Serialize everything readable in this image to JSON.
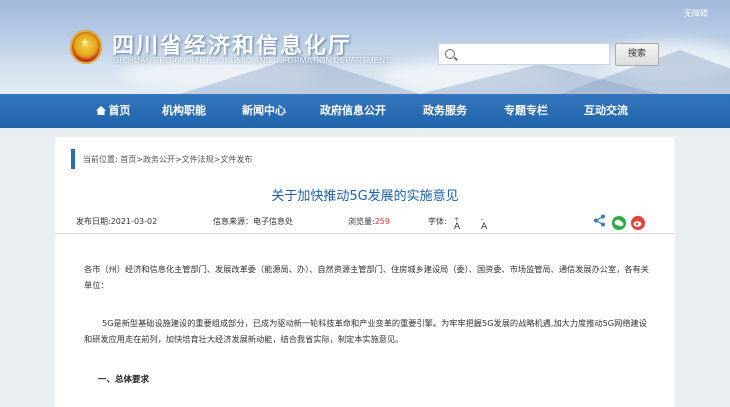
{
  "header": {
    "accessibility_label": "无障碍",
    "site_title": "四川省经济和信息化厅",
    "site_subtitle": "SICHUAN PROVINCIAL ECONOMIC AND INFORMATION DEPARTMENT",
    "search": {
      "placeholder": "",
      "value": "",
      "button_label": "搜索"
    }
  },
  "nav": {
    "items": [
      {
        "label": "首页",
        "icon": "home-icon"
      },
      {
        "label": "机构职能"
      },
      {
        "label": "新闻中心"
      },
      {
        "label": "政府信息公开"
      },
      {
        "label": "政务服务"
      },
      {
        "label": "专题专栏"
      },
      {
        "label": "互动交流"
      }
    ]
  },
  "breadcrumb": {
    "prefix": "当前位置:",
    "path": "首页>政务公开>文件法规>文件发布"
  },
  "article": {
    "title": "关于加快推动5G发展的实施意见",
    "meta": {
      "date_label": "发布日期:2021-03-02",
      "source_label": "信息来源：电子信息处",
      "views_label": "浏览量:",
      "views_value": "259",
      "font_label": "字体:",
      "font_increase": "A",
      "font_decrease": "A",
      "share_icons": [
        "share-icon",
        "wechat-icon",
        "weibo-icon"
      ]
    },
    "paragraphs": [
      "各市（州）经济和信息化主管部门、发展改革委（能源局、办）、自然资源主管部门、住房城乡建设局（委）、国资委、市场监管局、通信发展办公室，各有关单位：",
      "5G是新型基础设施建设的重要组成部分，已成为驱动新一轮科技革命和产业变革的重要引擎。为牢牢把握5G发展的战略机遇,加大力度推动5G网络建设和研发应用走在前列，加快培育壮大经济发展新动能，结合我省实际，制定本实施意见。"
    ],
    "section_heading": "一、总体要求"
  },
  "colors": {
    "nav_bg": "#2a6db5",
    "title_color": "#1f5fae",
    "views_color": "#e0322b"
  }
}
